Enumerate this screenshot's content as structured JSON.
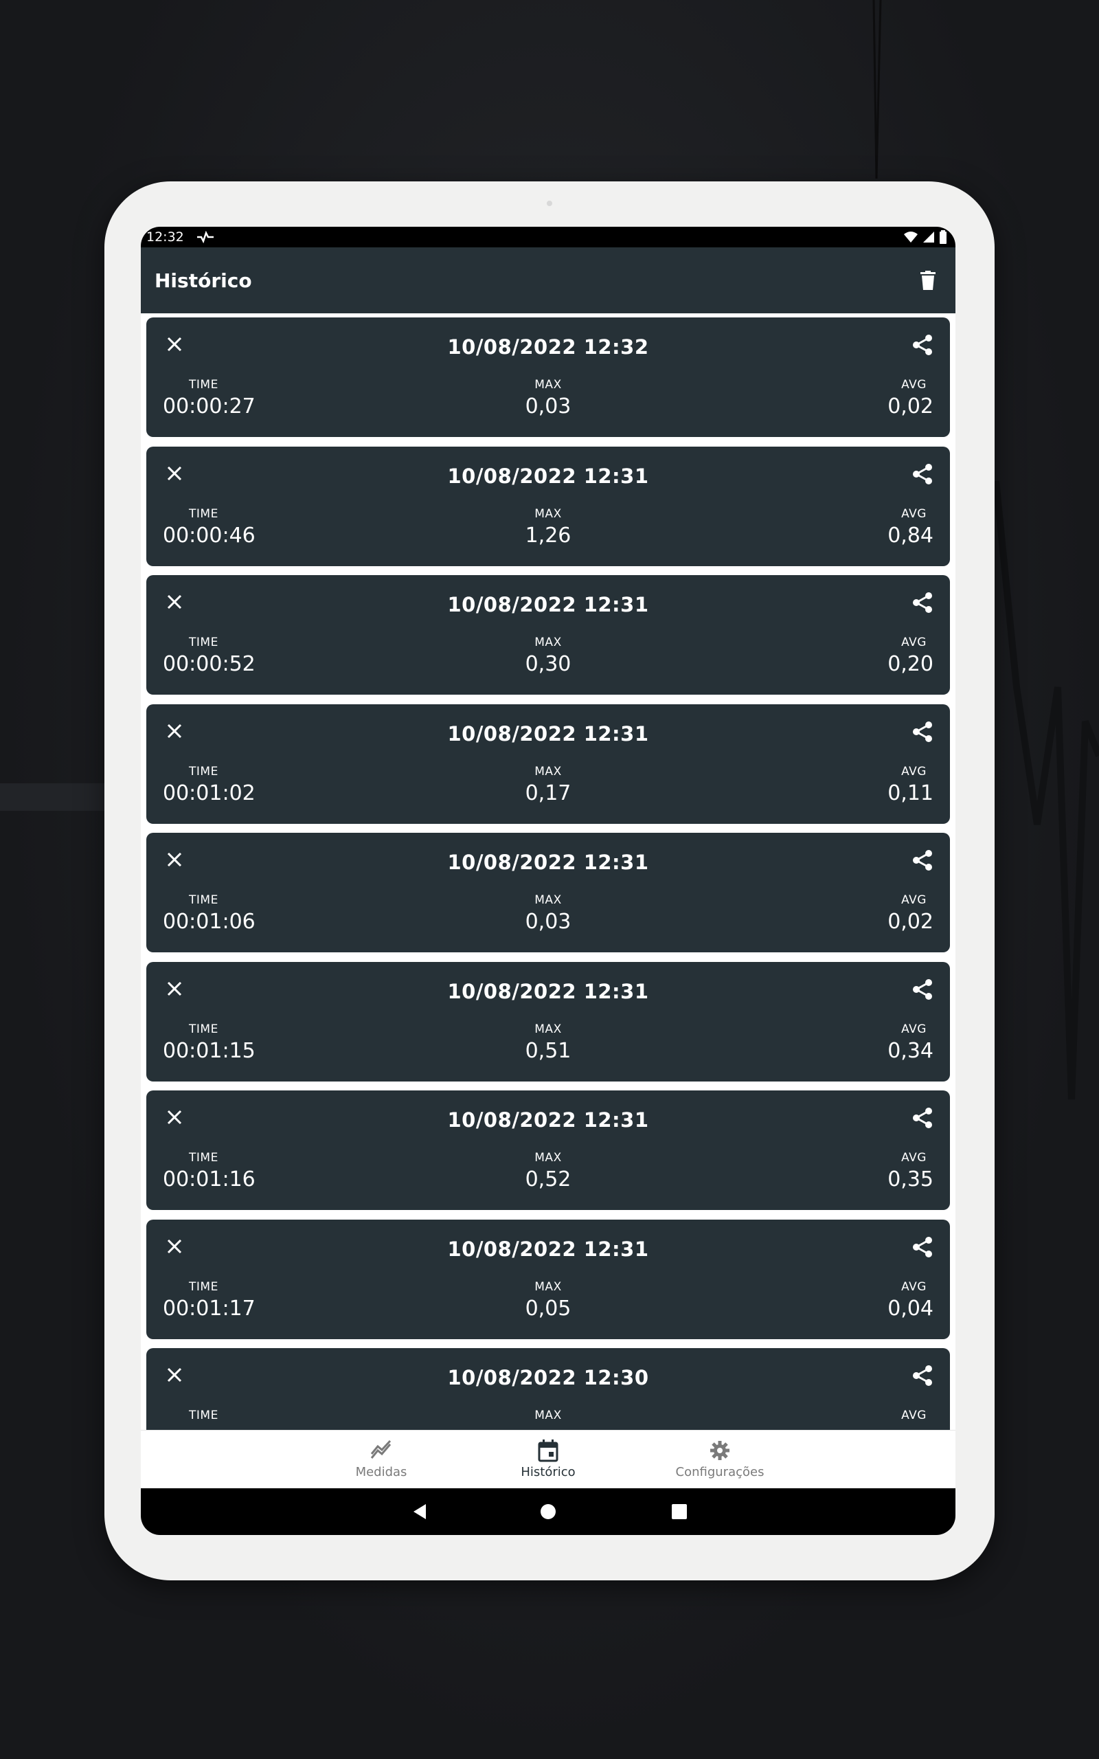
{
  "status_bar": {
    "time": "12:32"
  },
  "app_bar": {
    "title": "Histórico"
  },
  "labels": {
    "time": "TIME",
    "max": "MAX",
    "avg": "AVG"
  },
  "records": [
    {
      "date": "10/08/2022 12:32",
      "time": "00:00:27",
      "max": "0,03",
      "avg": "0,02"
    },
    {
      "date": "10/08/2022 12:31",
      "time": "00:00:46",
      "max": "1,26",
      "avg": "0,84"
    },
    {
      "date": "10/08/2022 12:31",
      "time": "00:00:52",
      "max": "0,30",
      "avg": "0,20"
    },
    {
      "date": "10/08/2022 12:31",
      "time": "00:01:02",
      "max": "0,17",
      "avg": "0,11"
    },
    {
      "date": "10/08/2022 12:31",
      "time": "00:01:06",
      "max": "0,03",
      "avg": "0,02"
    },
    {
      "date": "10/08/2022 12:31",
      "time": "00:01:15",
      "max": "0,51",
      "avg": "0,34"
    },
    {
      "date": "10/08/2022 12:31",
      "time": "00:01:16",
      "max": "0,52",
      "avg": "0,35"
    },
    {
      "date": "10/08/2022 12:31",
      "time": "00:01:17",
      "max": "0,05",
      "avg": "0,04"
    },
    {
      "date": "10/08/2022 12:30",
      "time": "",
      "max": "",
      "avg": ""
    }
  ],
  "bottom_nav": {
    "items": [
      {
        "label": "Medidas",
        "icon": "chart-line-icon"
      },
      {
        "label": "Histórico",
        "icon": "calendar-icon",
        "active": true
      },
      {
        "label": "Configurações",
        "icon": "gear-icon"
      }
    ]
  },
  "colors": {
    "card_bg": "#263137",
    "app_bar_bg": "#263137",
    "text": "#ffffff",
    "nav_inactive": "#7a7a7a"
  }
}
